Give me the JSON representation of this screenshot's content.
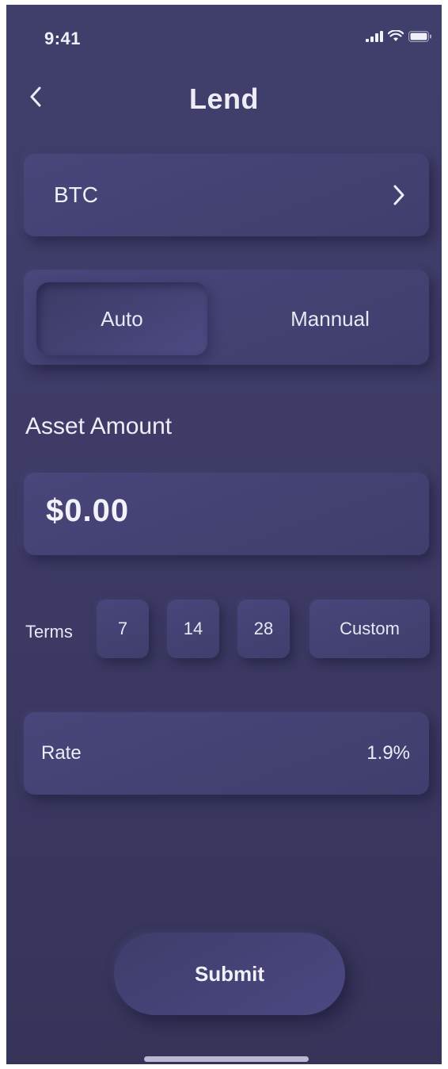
{
  "status_bar": {
    "time": "9:41",
    "icons": [
      "cellular-signal-icon",
      "wifi-icon",
      "battery-icon"
    ]
  },
  "nav": {
    "title": "Lend",
    "back_icon": "chevron-left-icon"
  },
  "asset_selector": {
    "value": "BTC",
    "icon": "chevron-right-icon"
  },
  "mode_toggle": {
    "options": [
      "Auto",
      "Mannual"
    ],
    "selected": "Auto"
  },
  "asset_amount": {
    "label": "Asset Amount",
    "value": "$0.00"
  },
  "terms": {
    "label": "Terms",
    "options": [
      "7",
      "14",
      "28",
      "Custom"
    ]
  },
  "rate": {
    "label": "Rate",
    "value": "1.9%"
  },
  "submit": {
    "label": "Submit"
  },
  "colors": {
    "background": "#3d3b66",
    "card": "#45437a",
    "text": "#eeedf7"
  }
}
